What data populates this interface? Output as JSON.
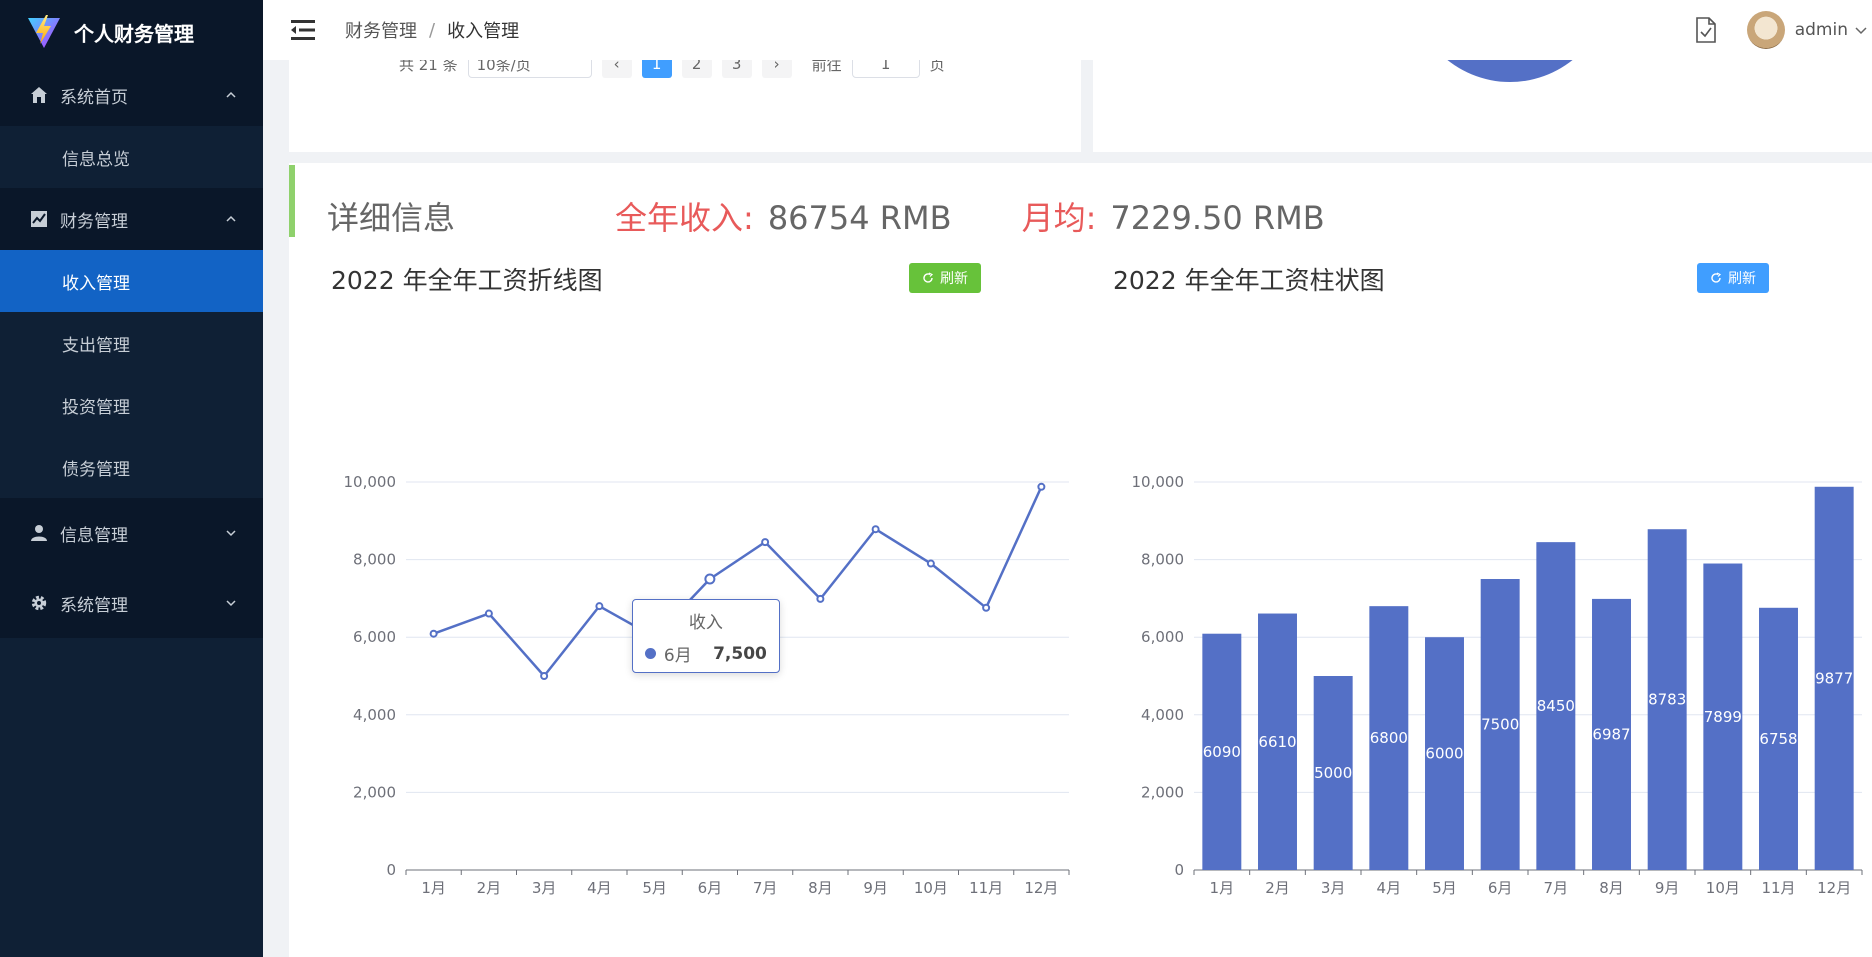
{
  "sidebar": {
    "brand": "个人财务管理",
    "groups": [
      {
        "label": "系统首页",
        "icon": "home-icon",
        "expanded": true,
        "items": [
          {
            "label": "信息总览"
          }
        ]
      },
      {
        "label": "财务管理",
        "icon": "chart-icon",
        "expanded": true,
        "items": [
          {
            "label": "收入管理",
            "active": true
          },
          {
            "label": "支出管理"
          },
          {
            "label": "投资管理"
          },
          {
            "label": "债务管理"
          }
        ]
      },
      {
        "label": "信息管理",
        "icon": "user-icon",
        "expanded": false,
        "items": []
      },
      {
        "label": "系统管理",
        "icon": "gear-icon",
        "expanded": false,
        "items": []
      }
    ]
  },
  "header": {
    "breadcrumb": [
      "财务管理",
      "收入管理"
    ],
    "breadcrumb_sep": "/",
    "username": "admin"
  },
  "pager": {
    "total": "共 21 条",
    "page_size": "10条/页",
    "pages": [
      "1",
      "2",
      "3"
    ],
    "goto": "前往",
    "goto_value": "1",
    "page_suffix": "页"
  },
  "summary": {
    "title": "详细信息",
    "year_label": "全年收入:",
    "year_value": "86754 RMB",
    "avg_label": "月均:",
    "avg_value": "7229.50 RMB"
  },
  "charts": {
    "line_title": "2022 年全年工资折线图",
    "bar_title": "2022 年全年工资柱状图",
    "refresh_label": "刷新",
    "tooltip": {
      "title": "收入",
      "month": "6月",
      "value": "7,500"
    },
    "colors": {
      "series": "#5470c6",
      "green": "#67c23a",
      "blue": "#409eff",
      "alert": "#e85a5a"
    }
  },
  "chart_data": [
    {
      "type": "line",
      "categories": [
        "1月",
        "2月",
        "3月",
        "4月",
        "5月",
        "6月",
        "7月",
        "8月",
        "9月",
        "10月",
        "11月",
        "12月"
      ],
      "series": [
        {
          "name": "收入",
          "values": [
            6090,
            6610,
            5000,
            6800,
            6000,
            7500,
            8450,
            6987,
            8783,
            7899,
            6758,
            9877
          ]
        }
      ],
      "yticks": [
        "0",
        "2,000",
        "4,000",
        "6,000",
        "8,000",
        "10,000"
      ],
      "ylim": [
        0,
        10000
      ],
      "grid": true
    },
    {
      "type": "bar",
      "categories": [
        "1月",
        "2月",
        "3月",
        "4月",
        "5月",
        "6月",
        "7月",
        "8月",
        "9月",
        "10月",
        "11月",
        "12月"
      ],
      "values": [
        6090,
        6610,
        5000,
        6800,
        6000,
        7500,
        8450,
        6987,
        8783,
        7899,
        6758,
        9877
      ],
      "yticks": [
        "0",
        "2,000",
        "4,000",
        "6,000",
        "8,000",
        "10,000"
      ],
      "ylim": [
        0,
        10000
      ],
      "grid": true
    }
  ]
}
